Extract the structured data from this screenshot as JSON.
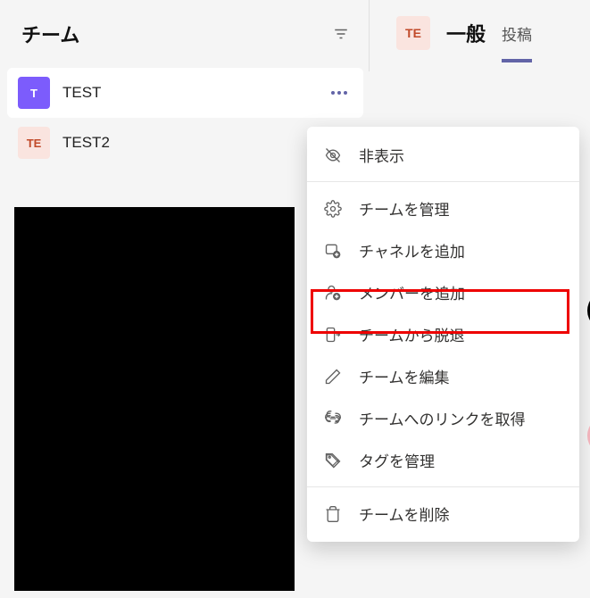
{
  "leftPanel": {
    "title": "チーム"
  },
  "teams": [
    {
      "initial": "T",
      "name": "TEST"
    },
    {
      "initial": "TE",
      "name": "TEST2"
    }
  ],
  "rightHeader": {
    "avatarInitial": "TE",
    "channelName": "一般",
    "tabPosts": "投稿"
  },
  "menu": {
    "hide": "非表示",
    "manageTeam": "チームを管理",
    "addChannel": "チャネルを追加",
    "addMember": "メンバーを追加",
    "leaveTeam": "チームから脱退",
    "editTeam": "チームを編集",
    "getLink": "チームへのリンクを取得",
    "manageTags": "タグを管理",
    "deleteTeam": "チームを削除"
  }
}
